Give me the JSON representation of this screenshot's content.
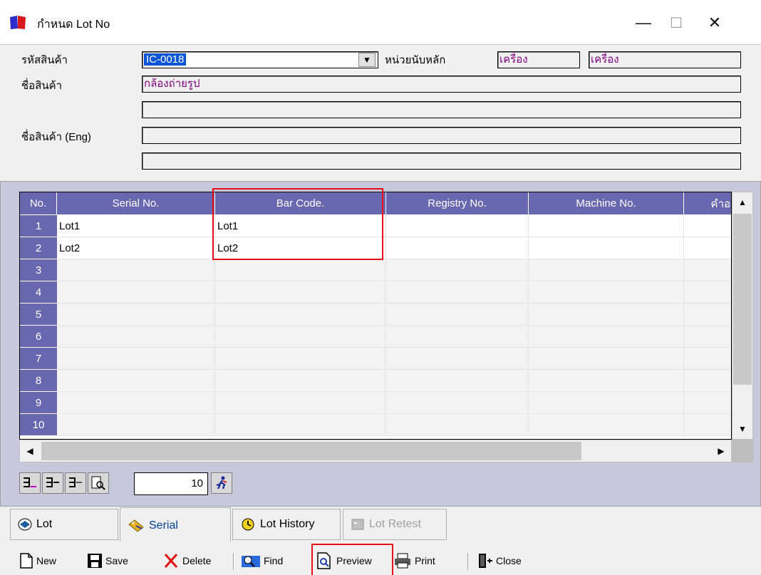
{
  "window": {
    "title": "กำหนด Lot No",
    "minimize": "—",
    "maximize": "☐",
    "close": "✕"
  },
  "form": {
    "code_label": "รหัสสินค้า",
    "code_value": "IC-0018",
    "unit_label": "หน่วยนับหลัก",
    "unit_value_1": "เครื่อง",
    "unit_value_2": "เครื่อง",
    "name_label": "ชื่อสินค้า",
    "name_value": "กล้องถ่ายรูป",
    "name2_value": "",
    "name_eng_label": "ชื่อสินค้า (Eng)",
    "name_eng_value": "",
    "name_eng2_value": ""
  },
  "grid": {
    "columns": [
      "No.",
      "Serial No.",
      "Bar Code.",
      "Registry No.",
      "Machine No.",
      "คำอ"
    ],
    "rows": [
      {
        "no": "1",
        "serial": "Lot1",
        "barcode": "Lot1"
      },
      {
        "no": "2",
        "serial": "Lot2",
        "barcode": "Lot2"
      },
      {
        "no": "3",
        "serial": "",
        "barcode": ""
      },
      {
        "no": "4",
        "serial": "",
        "barcode": ""
      },
      {
        "no": "5",
        "serial": "",
        "barcode": ""
      },
      {
        "no": "6",
        "serial": "",
        "barcode": ""
      },
      {
        "no": "7",
        "serial": "",
        "barcode": ""
      },
      {
        "no": "8",
        "serial": "",
        "barcode": ""
      },
      {
        "no": "9",
        "serial": "",
        "barcode": ""
      },
      {
        "no": "10",
        "serial": "",
        "barcode": ""
      }
    ]
  },
  "grid_toolbar": {
    "row_count": "10"
  },
  "tabs": [
    {
      "label": "Lot",
      "icon": "lot-icon"
    },
    {
      "label": "Serial",
      "icon": "serial-tag-icon"
    },
    {
      "label": "Lot History",
      "icon": "lot-history-icon"
    },
    {
      "label": "Lot Retest",
      "icon": "lot-retest-icon"
    }
  ],
  "toolbar": {
    "new_label": "New",
    "save_label": "Save",
    "delete_label": "Delete",
    "find_label": "Find",
    "preview_label": "Preview",
    "print_label": "Print",
    "close_label": "Close"
  },
  "colors": {
    "grid_header": "#6868b0",
    "panel_bg": "#c8c8dc",
    "field_text": "#800080",
    "highlight": "#e8101a",
    "selection": "#0a55d6"
  }
}
